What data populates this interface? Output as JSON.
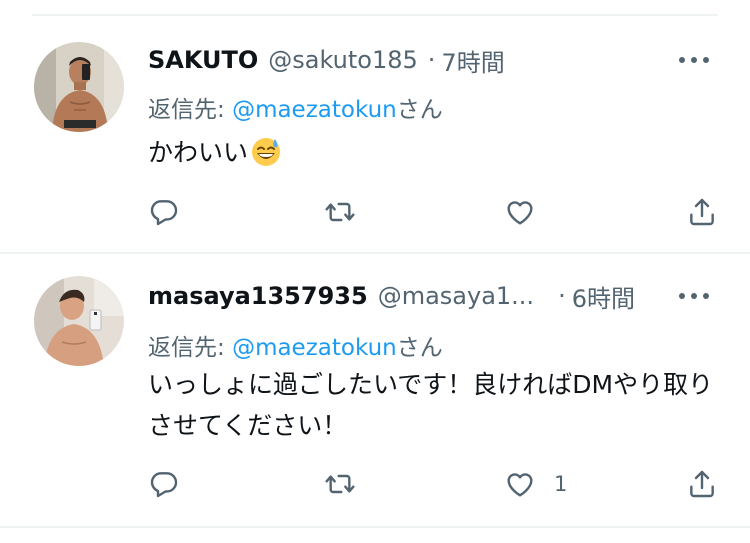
{
  "tweets": [
    {
      "display_name": "SAKUTO",
      "handle": "@sakuto185",
      "separator": "·",
      "time": "7時間",
      "reply_prefix": "返信先: ",
      "reply_mention": "@maezatokun",
      "reply_suffix": "さん",
      "text": "かわいい",
      "emoji": "grinning-face-with-sweat",
      "avatar": "profile photo (shirtless selfie)",
      "like_count": ""
    },
    {
      "display_name": "masaya1357935",
      "handle": "@masaya1...",
      "separator": "·",
      "time": "6時間",
      "reply_prefix": "返信先: ",
      "reply_mention": "@maezatokun",
      "reply_suffix": "さん",
      "text": "いっしょに過ごしたいです！良ければDMやり取りさせてください！",
      "avatar": "profile photo (shirtless mirror selfie)",
      "like_count": "1"
    }
  ],
  "icons": {
    "reply": "reply-icon",
    "retweet": "retweet-icon",
    "like": "heart-icon",
    "share": "share-icon",
    "more": "more-icon"
  },
  "colors": {
    "text": "#0f1419",
    "secondary": "#536471",
    "mention": "#1d9bf0",
    "divider": "#eff3f4"
  }
}
